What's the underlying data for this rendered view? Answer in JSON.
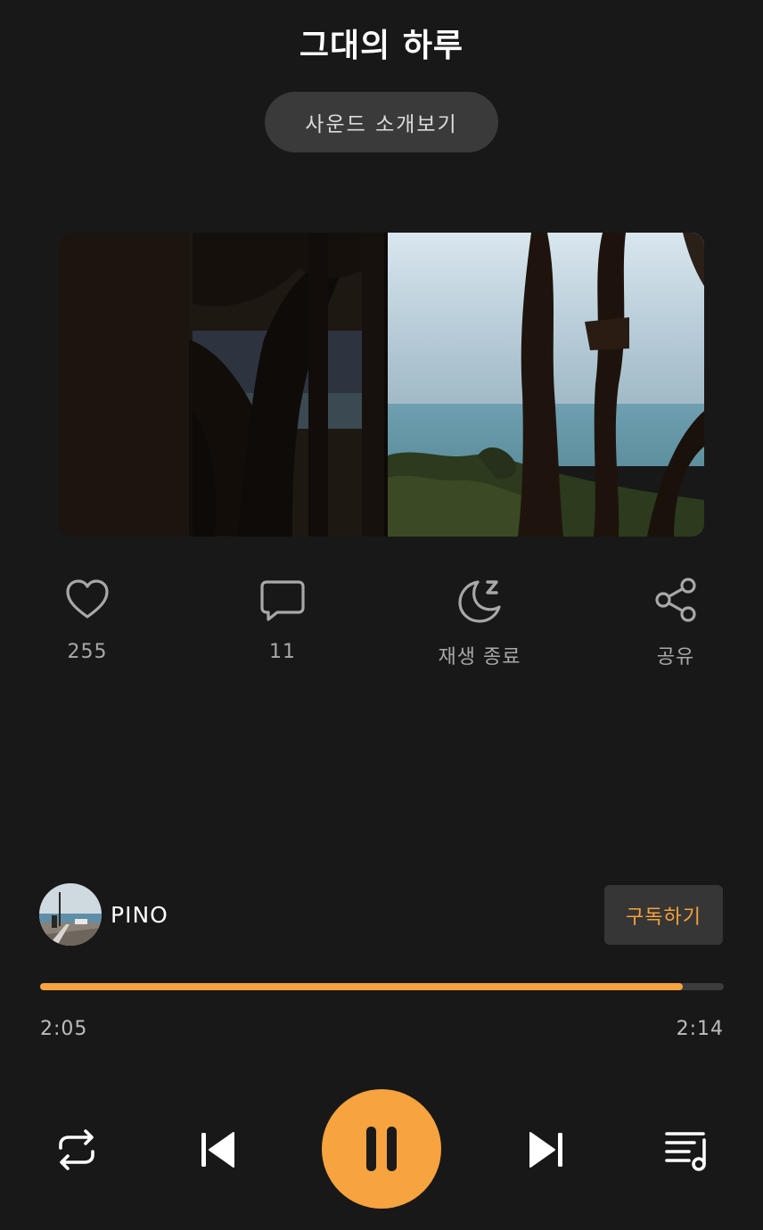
{
  "header": {
    "title": "그대의 하루",
    "intro_button": "사운드 소개보기"
  },
  "actions": [
    {
      "icon": "heart-icon",
      "label": "255"
    },
    {
      "icon": "comment-icon",
      "label": "11"
    },
    {
      "icon": "sleep-timer-icon",
      "label": "재생 종료"
    },
    {
      "icon": "share-icon",
      "label": "공유"
    }
  ],
  "channel": {
    "name": "PINO",
    "subscribe_label": "구독하기"
  },
  "player": {
    "current_time": "2:05",
    "total_time": "2:14",
    "progress_fraction": 0.94
  },
  "controls": [
    {
      "icon": "repeat-icon"
    },
    {
      "icon": "skip-previous-icon"
    },
    {
      "icon": "pause-icon"
    },
    {
      "icon": "skip-next-icon"
    },
    {
      "icon": "playlist-icon"
    }
  ],
  "colors": {
    "background": "#181818",
    "accent": "#f7a33f",
    "button_bg": "#3a3a3a"
  }
}
